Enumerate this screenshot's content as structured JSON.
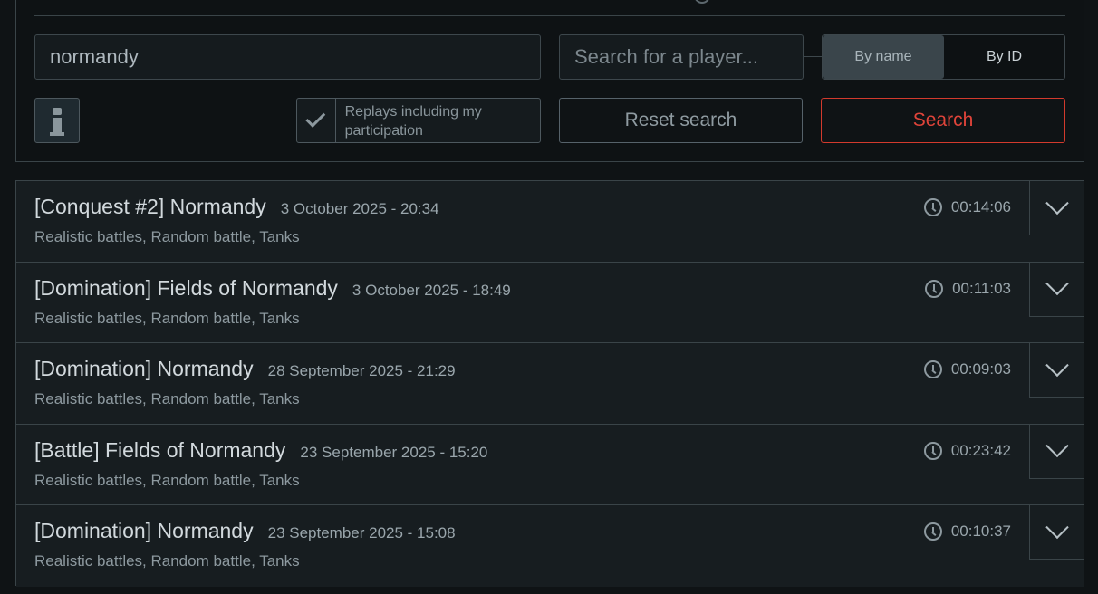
{
  "search": {
    "query_value": "normandy",
    "player_placeholder": "Search for a player...",
    "toggle": {
      "by_name": "By name",
      "by_id": "By ID",
      "selected": "By name"
    },
    "participation_label": "Replays including my participation",
    "participation_checked": true,
    "reset_label": "Reset search",
    "search_label": "Search"
  },
  "icons": {
    "info": "info-icon",
    "check": "checkmark-icon",
    "clock": "clock-icon",
    "expand": "chevron-down-icon"
  },
  "colors": {
    "accent": "#e0443a",
    "background": "#0f1315",
    "row_bg": "#171d20"
  },
  "replays": [
    {
      "title": "[Conquest #2] Normandy",
      "date": "3 October 2025 - 20:34",
      "duration": "00:14:06",
      "meta": "Realistic battles, Random battle, Tanks"
    },
    {
      "title": "[Domination] Fields of Normandy",
      "date": "3 October 2025 - 18:49",
      "duration": "00:11:03",
      "meta": "Realistic battles, Random battle, Tanks"
    },
    {
      "title": "[Domination] Normandy",
      "date": "28 September 2025 - 21:29",
      "duration": "00:09:03",
      "meta": "Realistic battles, Random battle, Tanks"
    },
    {
      "title": "[Battle] Fields of Normandy",
      "date": "23 September 2025 - 15:20",
      "duration": "00:23:42",
      "meta": "Realistic battles, Random battle, Tanks"
    },
    {
      "title": "[Domination] Normandy",
      "date": "23 September 2025 - 15:08",
      "duration": "00:10:37",
      "meta": "Realistic battles, Random battle, Tanks"
    }
  ]
}
